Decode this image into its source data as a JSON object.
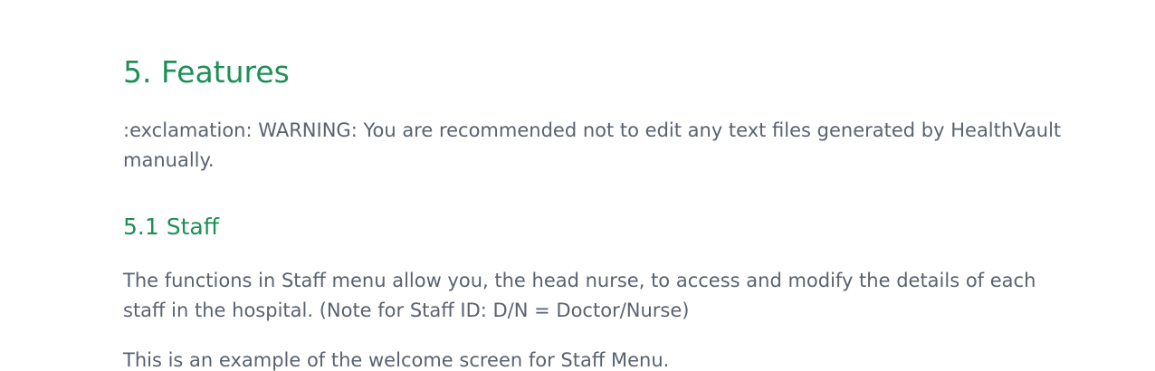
{
  "section": {
    "heading": "5. Features",
    "warning_text": ":exclamation: WARNING: You are recommended not to edit any text files generated by HealthVault manually."
  },
  "subsection": {
    "heading": "5.1 Staff",
    "description": "The functions in Staff menu allow you, the head nurse, to access and modify the details of each staff in the hospital. (Note for Staff ID: D/N = Doctor/Nurse)",
    "example_text": "This is an example of the welcome screen for Staff Menu."
  },
  "colors": {
    "heading": "#1e8f57",
    "body_text": "#5a6270",
    "background": "#ffffff"
  }
}
